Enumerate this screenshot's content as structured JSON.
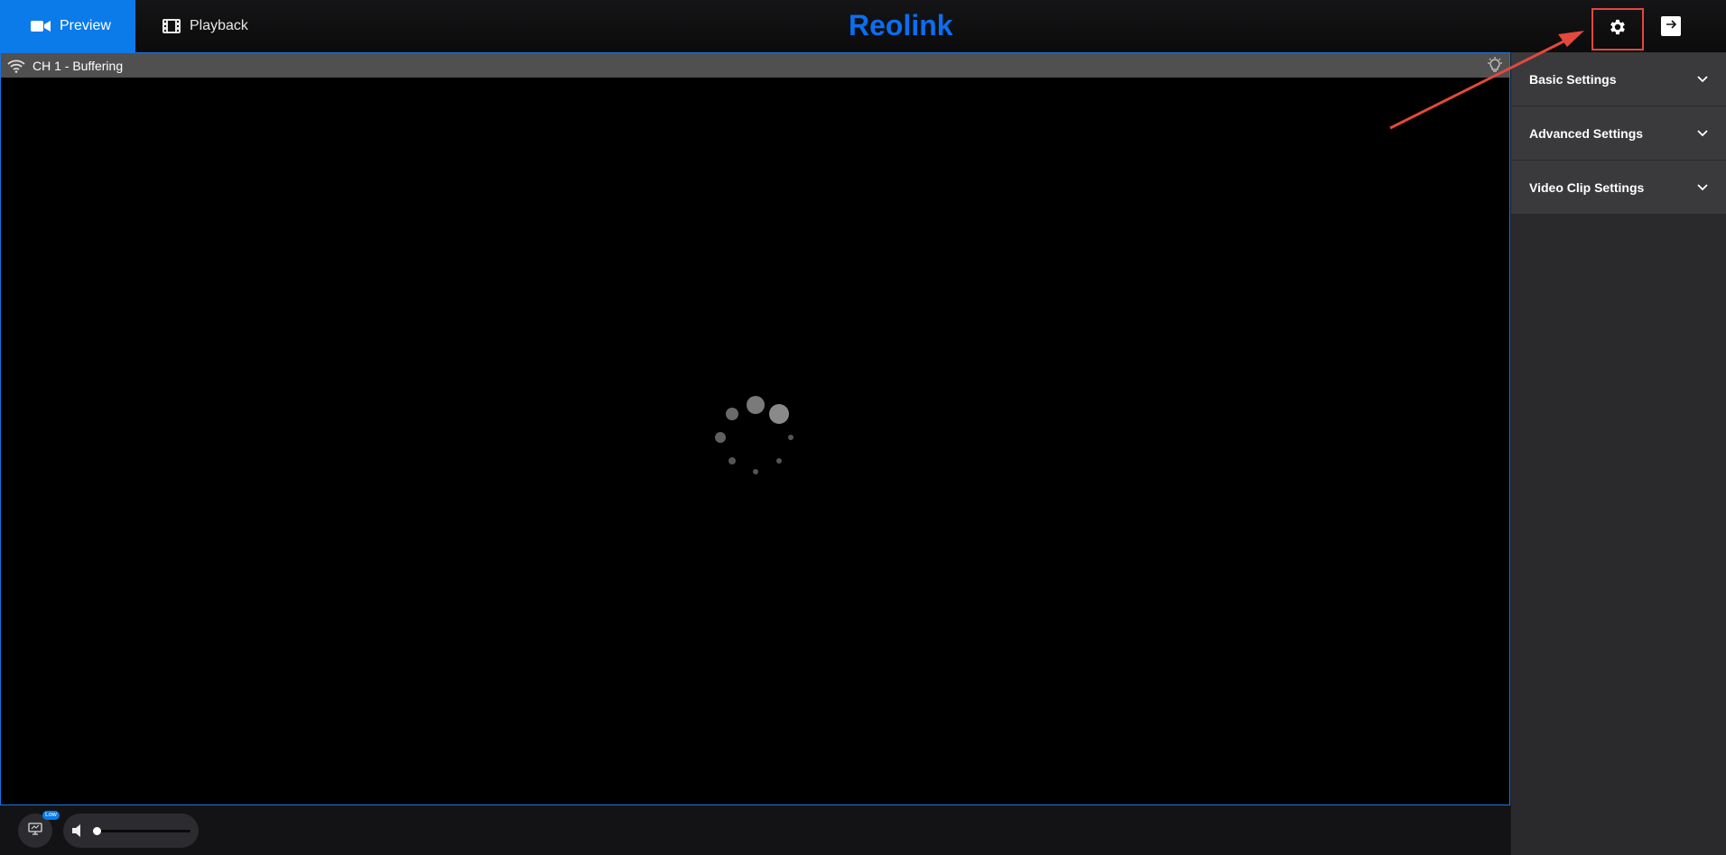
{
  "nav": {
    "preview_label": "Preview",
    "playback_label": "Playback"
  },
  "brand": {
    "logo_text": "Reolink",
    "color": "#0b6ef0"
  },
  "header_actions": {
    "settings_icon": "gear-icon",
    "logout_icon": "logout-arrow-icon",
    "highlight_color": "#e5483d"
  },
  "video": {
    "channel_label": "CH 1 - Buffering",
    "status_icon": "wifi-icon",
    "light_icon": "lightbulb-icon"
  },
  "controls": {
    "stream_badge": "Low",
    "volume_level": 0
  },
  "sidebar": {
    "items": [
      {
        "label": "Basic Settings"
      },
      {
        "label": "Advanced Settings"
      },
      {
        "label": "Video Clip Settings"
      }
    ]
  },
  "colors": {
    "accent": "#0b7bea",
    "annotation": "#e5483d"
  }
}
